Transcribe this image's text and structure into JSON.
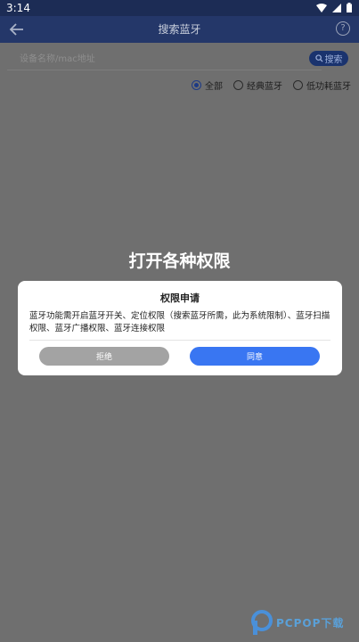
{
  "status_bar": {
    "time": "3:14"
  },
  "app_bar": {
    "title": "搜索蓝牙",
    "help_symbol": "?"
  },
  "search": {
    "placeholder": "设备名称/mac地址",
    "button_label": "搜索"
  },
  "filters": [
    {
      "label": "全部",
      "checked": true
    },
    {
      "label": "经典蓝牙",
      "checked": false
    },
    {
      "label": "低功耗蓝牙",
      "checked": false
    }
  ],
  "overlay_title": "打开各种权限",
  "dialog": {
    "title": "权限申请",
    "body": "蓝牙功能需开启蓝牙开关、定位权限（搜索蓝牙所需，此为系统限制）、蓝牙扫描权限、蓝牙广播权限、蓝牙连接权限",
    "reject_label": "拒绝",
    "agree_label": "同意"
  },
  "watermark": {
    "text": "PCPOP下载"
  },
  "colors": {
    "status_bar": "#1c2c55",
    "app_bar": "#243769",
    "scrim": "#6f6f6f",
    "agree": "#3976f2",
    "reject": "#a3a3a3"
  }
}
